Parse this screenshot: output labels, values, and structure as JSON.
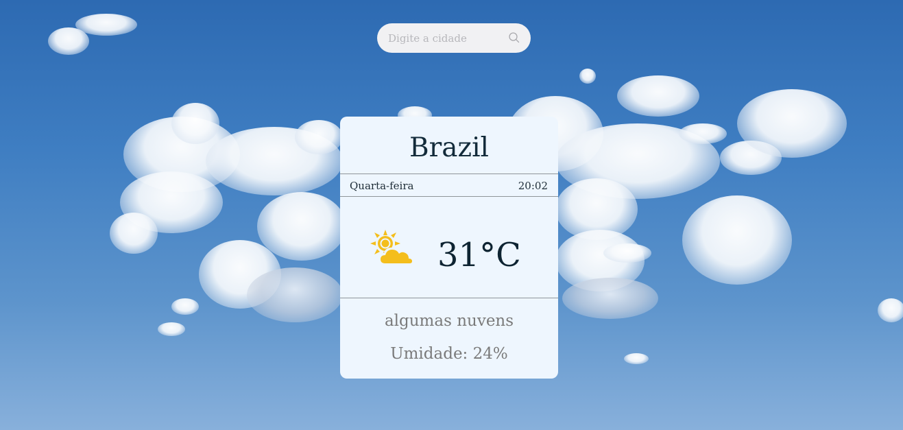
{
  "search": {
    "placeholder": "Digite a cidade",
    "value": "",
    "button_icon": "search-icon"
  },
  "weather": {
    "city": "Brazil",
    "weekday": "Quarta-feira",
    "time": "20:02",
    "temperature": "31°C",
    "icon": "partly-cloudy-icon",
    "description": "algumas nuvens",
    "humidity": "Umidade: 24%"
  },
  "colors": {
    "sky": "#3f7ec2",
    "card_background": "#eef6fe",
    "search_background": "#f1f1f3",
    "icon_yellow": "#f4be1c",
    "primary_text": "#132b3a",
    "secondary_text": "#7a7a7a"
  }
}
